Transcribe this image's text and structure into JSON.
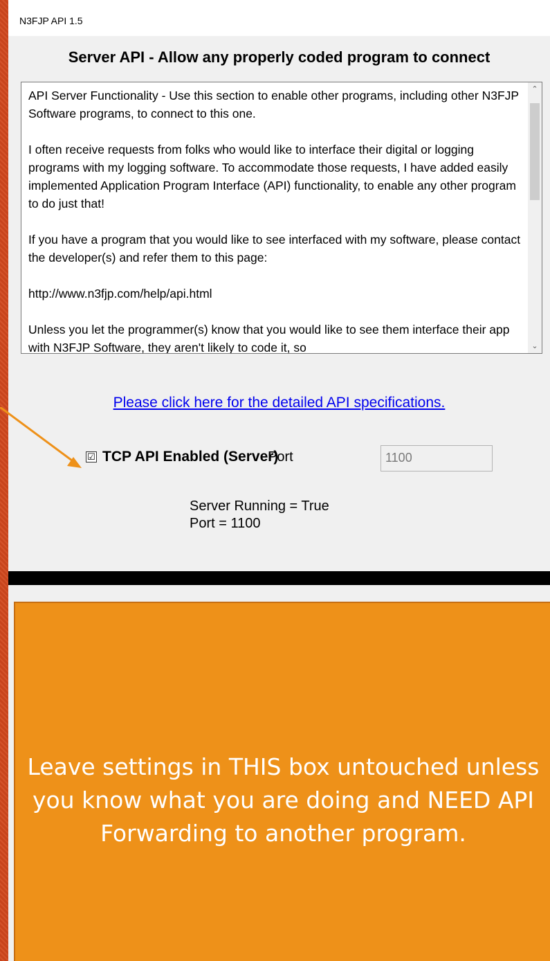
{
  "window": {
    "title": "N3FJP API  1.5"
  },
  "server_api": {
    "heading": "Server API - Allow any properly coded program to connect",
    "description_paragraphs": [
      "API Server Functionality - Use this section to enable other programs, including other N3FJP Software programs, to connect to this one.",
      "I often receive requests from folks who would like to interface their digital or logging programs with my logging software.  To accommodate those requests, I have added easily implemented Application Program Interface (API) functionality, to enable any other program to do just that!",
      "If you have a program that you would like to see interfaced with my software, please contact the developer(s) and refer them to this page:",
      "http://www.n3fjp.com/help/api.html",
      "Unless you let the programmer(s) know that you would like to see them interface their app with N3FJP Software, they aren't likely to code it, so"
    ],
    "scroll_up_glyph": "⌃",
    "scroll_down_glyph": "⌄",
    "spec_link": "Please click here for the detailed API specifications.",
    "tcp_checkbox_glyph": "☑",
    "tcp_checkbox_label": "TCP API Enabled (Server)",
    "tcp_checked": true,
    "port_label": "Port",
    "port_value": "1100",
    "status_line1": "Server Running = True",
    "status_line2": "Port = 1100"
  },
  "callout": {
    "text": "Leave settings in THIS box untouched unless you know what you are doing and NEED API Forwarding to another program."
  },
  "colors": {
    "annotation_orange": "#ee9119",
    "link_blue": "#0000ee",
    "slide_background": "#c8441c"
  }
}
